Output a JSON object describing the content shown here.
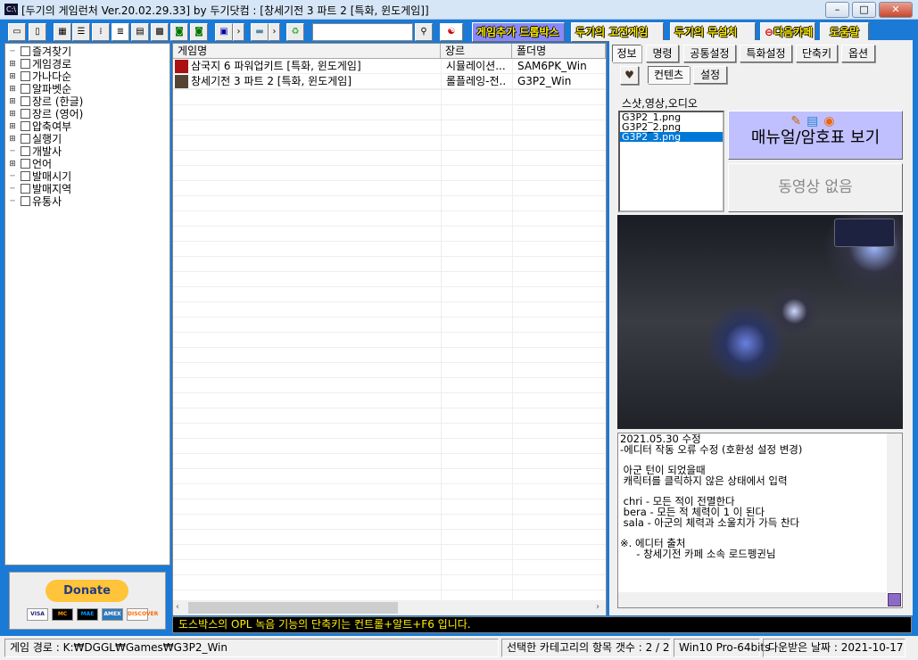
{
  "window": {
    "title": "[두기의 게임런처 Ver.20.02.29.33] by 두기닷컴 : [창세기전 3 파트 2 [특화, 윈도게임]]",
    "min": "–",
    "max": "□",
    "close": "✕"
  },
  "toolbar": {
    "search_value": "",
    "buttons": [
      "게임추가 드롭박스",
      "두기의 고전게임",
      "두기의 무설치",
      "다음카페",
      "도움말"
    ]
  },
  "tree": {
    "items": [
      {
        "label": "즐겨찾기",
        "expandable": false
      },
      {
        "label": "게임경로",
        "expandable": true
      },
      {
        "label": "가나다순",
        "expandable": true
      },
      {
        "label": "알파벳순",
        "expandable": true
      },
      {
        "label": "장르 (한글)",
        "expandable": true
      },
      {
        "label": "장르 (영어)",
        "expandable": true
      },
      {
        "label": "압축여부",
        "expandable": true
      },
      {
        "label": "실행기",
        "expandable": true
      },
      {
        "label": "개발사",
        "expandable": false
      },
      {
        "label": "언어",
        "expandable": true
      },
      {
        "label": "발매시기",
        "expandable": false
      },
      {
        "label": "발매지역",
        "expandable": false
      },
      {
        "label": "유통사",
        "expandable": false
      }
    ]
  },
  "donate": {
    "label": "Donate",
    "cards": [
      "VISA",
      "MC",
      "MAE",
      "AMEX",
      "DISCOVER"
    ]
  },
  "list": {
    "columns": [
      "게임명",
      "장르",
      "폴더명"
    ],
    "rows": [
      {
        "name": "삼국지 6 파워업키트 [특화, 윈도게임]",
        "genre": "시뮬레이션...",
        "folder": "SAM6PK_Win"
      },
      {
        "name": "창세기전 3 파트 2 [특화, 윈도게임]",
        "genre": "롤플레잉-전..",
        "folder": "G3P2_Win"
      }
    ]
  },
  "right": {
    "tabs": [
      "정보",
      "명령",
      "공통설정",
      "특화설정",
      "단축키",
      "옵션"
    ],
    "subtabs": [
      "컨텐츠",
      "설정"
    ],
    "media_label": "스샷,영상,오디오",
    "files": [
      "G3P2_1.png",
      "G3P2_2.png",
      "G3P2_3.png"
    ],
    "selected_file": 2,
    "manual_button": "매뉴얼/암호표 보기",
    "video_button": "동영상 없음",
    "notes": "2021.05.30 수정\n-에디터 작동 오류 수정 (호환성 설정 변경)\n\n 아군 턴이 되었을때\n 캐릭터를 클릭하지 않은 상태에서 입력\n\n chri - 모든 적이 전멸한다\n bera - 모든 적 체력이 1 이 된다\n sala - 아군의 체력과 소울치가 가득 찬다\n\n※. 에디터 출처\n     - 창세기전 카페 소속 로드펭귄님"
  },
  "marquee": "도스박스의 OPL 녹음 기능의 단축키는 컨트롤+알트+F6 입니다.",
  "status": {
    "path": "게임 경로 : K:₩DGGL₩Games₩G3P2_Win",
    "count": "선택한 카테고리의 항목 갯수 : 2 / 2",
    "os": "Win10 Pro-64bits",
    "date": "다운받은 날짜 : 2021-10-17"
  }
}
